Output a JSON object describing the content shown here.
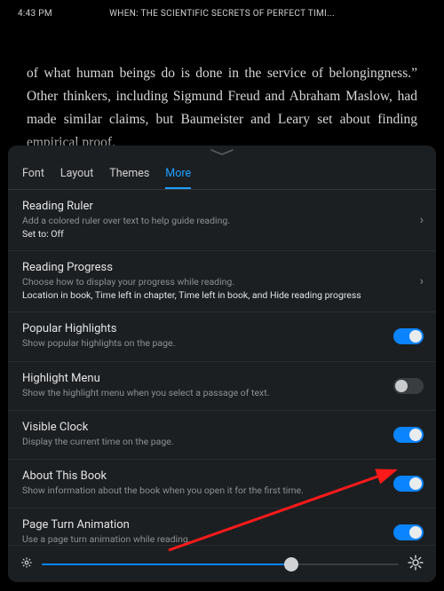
{
  "status": {
    "time": "4:43 PM",
    "book_title": "WHEN: THE SCIENTIFIC SECRETS OF PERFECT TIMI..."
  },
  "book_excerpt": "of what human beings do is done in the service of be­longingness.” Other thinkers, including Sigmund Freud and Abraham Maslow, had made similar claims, but Bau­meister and Leary set about finding empirical proof.",
  "tabs": {
    "font": "Font",
    "layout": "Layout",
    "themes": "Themes",
    "more": "More"
  },
  "rows": {
    "reading_ruler": {
      "title": "Reading Ruler",
      "desc": "Add a colored ruler over text to help guide reading.",
      "value": "Set to: Off"
    },
    "reading_progress": {
      "title": "Reading Progress",
      "desc": "Choose how to display your progress while reading.",
      "value": "Location in book, Time left in chapter, Time left in book, and Hide reading progress"
    },
    "popular_highlights": {
      "title": "Popular Highlights",
      "desc": "Show popular highlights on the page.",
      "on": true
    },
    "highlight_menu": {
      "title": "Highlight Menu",
      "desc": "Show the highlight menu when you select a passage of text.",
      "on": false
    },
    "visible_clock": {
      "title": "Visible Clock",
      "desc": "Display the current time on the page.",
      "on": true
    },
    "about_book": {
      "title": "About This Book",
      "desc": "Show information about the book when you open it for the first time.",
      "on": true
    },
    "page_turn_anim": {
      "title": "Page Turn Animation",
      "desc": "Use a page turn animation while reading.",
      "on": true
    }
  },
  "brightness_percent": 70
}
